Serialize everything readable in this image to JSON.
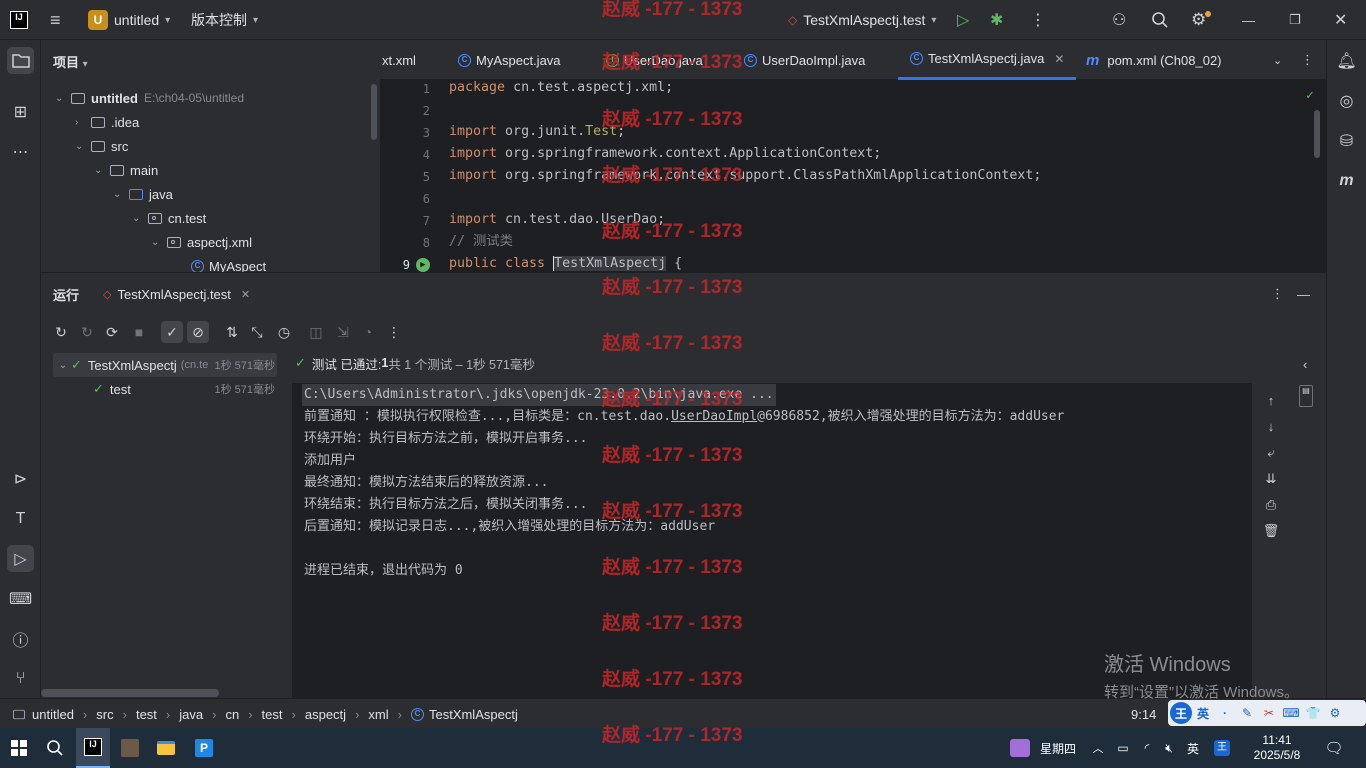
{
  "titlebar": {
    "app_icon": "intellij-icon",
    "menu_icon": "hamburger-icon",
    "project_badge": "U",
    "project_name": "untitled",
    "vcs_label": "版本控制",
    "run_config": "TestXmlAspectj.test",
    "icons": [
      "run-icon",
      "debug-icon",
      "more-icon",
      "add-user-icon",
      "search-icon",
      "settings-icon",
      "minimize-icon",
      "maximize-icon",
      "close-icon"
    ]
  },
  "project_panel": {
    "title": "项目",
    "items": [
      {
        "label": "untitled",
        "hint": "E:\\ch04-05\\untitled",
        "type": "module",
        "expanded": true
      },
      {
        "label": ".idea",
        "type": "folder",
        "expanded": false
      },
      {
        "label": "src",
        "type": "folder",
        "expanded": true
      },
      {
        "label": "main",
        "type": "folder",
        "expanded": true
      },
      {
        "label": "java",
        "type": "source-folder",
        "expanded": true
      },
      {
        "label": "cn.test",
        "type": "package",
        "expanded": true
      },
      {
        "label": "aspectj.xml",
        "type": "package",
        "expanded": true
      },
      {
        "label": "MyAspect",
        "type": "class"
      }
    ]
  },
  "editor": {
    "tabs": [
      {
        "label": "xt.xml",
        "active": false
      },
      {
        "label": "MyAspect.java",
        "active": false
      },
      {
        "label": "UserDao.java",
        "active": false
      },
      {
        "label": "UserDaoImpl.java",
        "active": false
      },
      {
        "label": "TestXmlAspectj.java",
        "active": true
      },
      {
        "label": "pom.xml (Ch08_02)",
        "active": false
      }
    ],
    "line_numbers": [
      "1",
      "2",
      "3",
      "4",
      "5",
      "6",
      "7",
      "8",
      "9"
    ],
    "lines": [
      "package cn.test.aspectj.xml;",
      "",
      "import org.junit.Test;",
      "import org.springframework.context.ApplicationContext;",
      "import org.springframework.context.support.ClassPathXmlApplicationContext;",
      "",
      "import cn.test.dao.UserDao;",
      "// 测试类",
      "public class TestXmlAspectj {"
    ]
  },
  "run_panel": {
    "title": "运行",
    "tab_label": "TestXmlAspectj.test",
    "status": "测试 已通过: 1共 1 个测试 – 1秒 571毫秒",
    "status_passed": "测试 已通过: ",
    "status_count": "1",
    "status_rest": "共 1 个测试 – 1秒 571毫秒",
    "tests": [
      {
        "label": "TestXmlAspectj",
        "hint": "(cn.te",
        "duration": "1秒 571毫秒"
      },
      {
        "label": "test",
        "duration": "1秒 571毫秒"
      }
    ],
    "console": [
      "C:\\Users\\Administrator\\.jdks\\openjdk-23.0.2\\bin\\java.exe ...",
      "前置通知 ：模拟执行权限检查...,目标类是：cn.test.dao.UserDaoImpl@6986852,被织入增强处理的目标方法为：addUser",
      "环绕开始：执行目标方法之前，模拟开启事务...",
      "添加用户",
      "最终通知：模拟方法结束后的释放资源...",
      "环绕结束：执行目标方法之后，模拟关闭事务...",
      "后置通知：模拟记录日志...,被织入增强处理的目标方法为：addUser",
      "",
      "进程已结束，退出代码为 0"
    ]
  },
  "statusbar": {
    "breadcrumbs": [
      "untitled",
      "src",
      "test",
      "java",
      "cn",
      "test",
      "aspectj",
      "xml",
      "TestXmlAspectj"
    ],
    "cursor": "9:14"
  },
  "watermark": "赵威 -177 - 1373",
  "activation": {
    "line1": "激活 Windows",
    "line2": "转到“设置”以激活 Windows。"
  },
  "ime": [
    "王",
    "英",
    "·",
    "✎",
    "⌨",
    "👕",
    "⚙"
  ],
  "taskbar": {
    "weekday": "星期四",
    "time": "11:41",
    "date": "2025/5/8",
    "tray_lang": "英",
    "tray_ime": "王"
  }
}
